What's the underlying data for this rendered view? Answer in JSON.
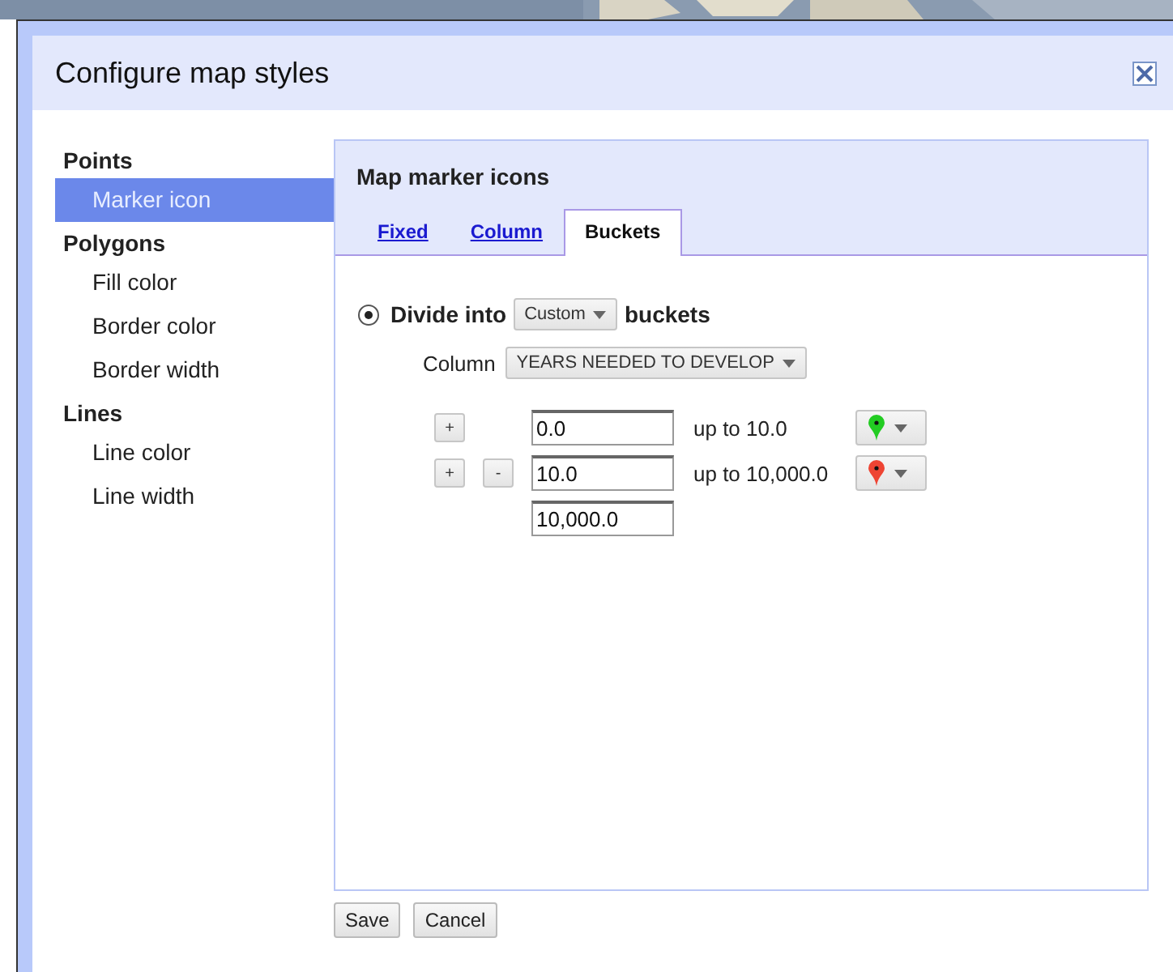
{
  "dialog": {
    "title": "Configure map styles"
  },
  "sidebar": {
    "groups": [
      {
        "label": "Points",
        "items": [
          {
            "label": "Marker icon",
            "selected": true
          }
        ]
      },
      {
        "label": "Polygons",
        "items": [
          {
            "label": "Fill color",
            "selected": false
          },
          {
            "label": "Border color",
            "selected": false
          },
          {
            "label": "Border width",
            "selected": false
          }
        ]
      },
      {
        "label": "Lines",
        "items": [
          {
            "label": "Line color",
            "selected": false
          },
          {
            "label": "Line width",
            "selected": false
          }
        ]
      }
    ]
  },
  "panel": {
    "title": "Map marker icons",
    "tabs": [
      {
        "label": "Fixed",
        "selected": false
      },
      {
        "label": "Column",
        "selected": false
      },
      {
        "label": "Buckets",
        "selected": true
      }
    ],
    "divide": {
      "selected": true,
      "label_before": "Divide into",
      "mode": "Custom",
      "label_after": "buckets"
    },
    "column": {
      "label": "Column",
      "value": "YEARS NEEDED TO DEVELOP"
    },
    "buckets": [
      {
        "add": "+",
        "from": "0.0",
        "range": "up to 10.0",
        "color": "#22cc22"
      },
      {
        "add": "+",
        "remove": "-",
        "from": "10.0",
        "range": "up to 10,000.0",
        "color": "#ee4433"
      }
    ],
    "last_value": "10,000.0"
  },
  "buttons": [
    "Save",
    "Cancel"
  ]
}
